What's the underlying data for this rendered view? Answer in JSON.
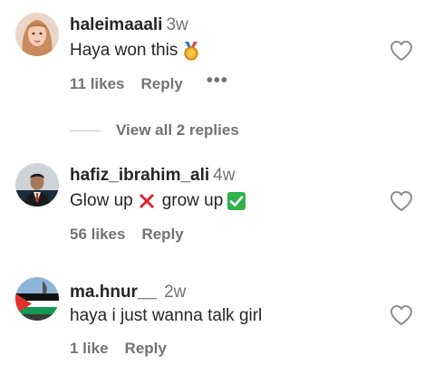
{
  "comments": [
    {
      "username": "haleimaaali",
      "time": "3w",
      "text": "Haya won this",
      "emoji": "medal-emoji",
      "likes": "11 likes",
      "reply": "Reply",
      "more": "•••"
    },
    {
      "username": "hafiz_ibrahim_ali",
      "time": "4w",
      "text_part1": "Glow up",
      "emoji_1": "cross-mark-emoji",
      "text_part2": "grow up",
      "emoji_2": "check-mark-emoji",
      "likes": "56 likes",
      "reply": "Reply"
    },
    {
      "username": "ma.hnur__",
      "time": "2w",
      "text": "haya i just wanna talk girl",
      "likes": "1 like",
      "reply": "Reply"
    }
  ],
  "view_replies": "View all 2 replies",
  "icons": {
    "like": "heart-outline-icon",
    "more": "more-options-icon"
  },
  "colors": {
    "text": "#262626",
    "secondary": "#737373",
    "cross": "#e0202a",
    "check": "#2fb24b"
  }
}
